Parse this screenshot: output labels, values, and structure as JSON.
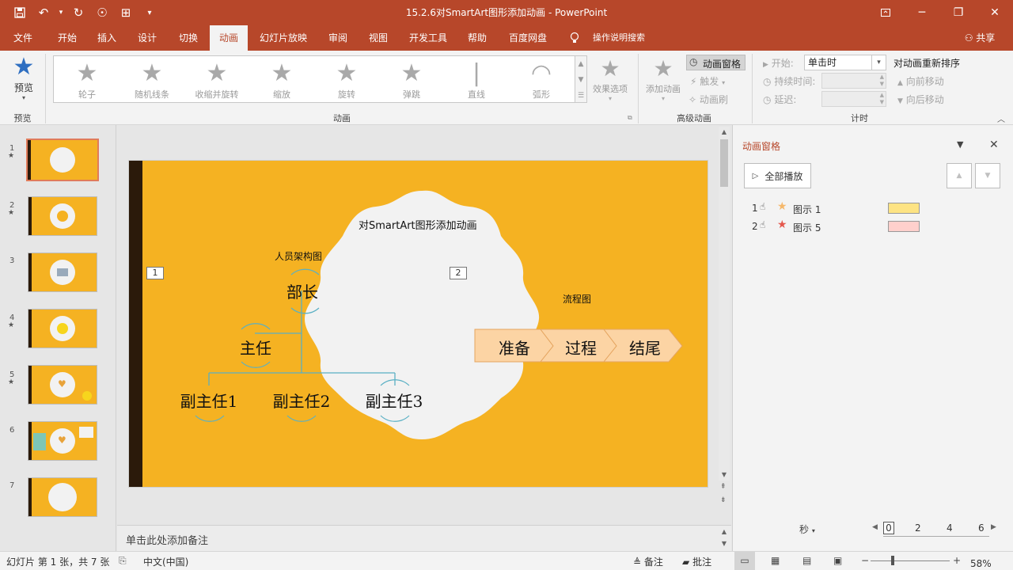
{
  "app": {
    "window_title": "15.2.6对SmartArt图形添加动画 - PowerPoint"
  },
  "quick_access": {
    "save_icon": "save-icon",
    "undo_icon": "undo-icon",
    "redo_icon": "redo-icon",
    "customize_icon": "chevron-down-icon"
  },
  "menu_tabs": [
    {
      "label": "文件"
    },
    {
      "label": "开始"
    },
    {
      "label": "插入"
    },
    {
      "label": "设计"
    },
    {
      "label": "切换"
    },
    {
      "label": "动画"
    },
    {
      "label": "幻灯片放映"
    },
    {
      "label": "审阅"
    },
    {
      "label": "视图"
    },
    {
      "label": "开发工具"
    },
    {
      "label": "帮助"
    },
    {
      "label": "百度网盘"
    }
  ],
  "tell_me": "操作说明搜索",
  "share": "共享",
  "ribbon": {
    "preview": {
      "button": "预览",
      "group": "预览"
    },
    "animation_group": "动画",
    "animations": [
      {
        "label": "轮子",
        "icon": "★"
      },
      {
        "label": "随机线条",
        "icon": "★"
      },
      {
        "label": "收缩并旋转",
        "icon": "★"
      },
      {
        "label": "缩放",
        "icon": "★"
      },
      {
        "label": "旋转",
        "icon": "★"
      },
      {
        "label": "弹跳",
        "icon": "★"
      },
      {
        "label": "直线",
        "icon": "|"
      },
      {
        "label": "弧形",
        "icon": "◠"
      }
    ],
    "effect_options": "效果选项",
    "advanced": {
      "group": "高级动画",
      "add_animation": "添加动画",
      "animation_pane": "动画窗格",
      "trigger": "触发",
      "painter": "动画刷"
    },
    "timing": {
      "group": "计时",
      "start_label": "开始:",
      "start_value": "单击时",
      "duration_label": "持续时间:",
      "delay_label": "延迟:",
      "reorder_title": "对动画重新排序",
      "move_earlier": "向前移动",
      "move_later": "向后移动"
    }
  },
  "slides": {
    "count": 7,
    "numbers": [
      "1",
      "2",
      "3",
      "4",
      "5",
      "6",
      "7"
    ],
    "selected": 1
  },
  "slide": {
    "title": "对SmartArt图形添加动画",
    "org_title": "人员架构图",
    "flow_title": "流程图",
    "tag1": "1",
    "tag2": "2",
    "boss": "部长",
    "manager": "主任",
    "deputies": [
      "副主任1",
      "副主任2",
      "副主任3"
    ],
    "steps": [
      "准备",
      "过程",
      "结尾"
    ]
  },
  "notes_placeholder": "单击此处添加备注",
  "animation_pane": {
    "title": "动画窗格",
    "play_all": "全部播放",
    "items": [
      {
        "index": "1",
        "name": "图示 1",
        "color": "#fde383",
        "star": "#f5b86b"
      },
      {
        "index": "2",
        "name": "图示 5",
        "color": "#ffd0cc",
        "star": "#e4574c"
      }
    ],
    "seconds": "秒",
    "timeline": [
      "0",
      "2",
      "4",
      "6"
    ]
  },
  "status": {
    "slide_info": "幻灯片 第 1 张，共 7 张",
    "language": "中文(中国)",
    "notes": "备注",
    "comments": "批注",
    "zoom": "58%"
  },
  "colors": {
    "accent": "#b7472a",
    "slide_bg": "#f5b222",
    "flow_fill": "#fcd4a4"
  }
}
